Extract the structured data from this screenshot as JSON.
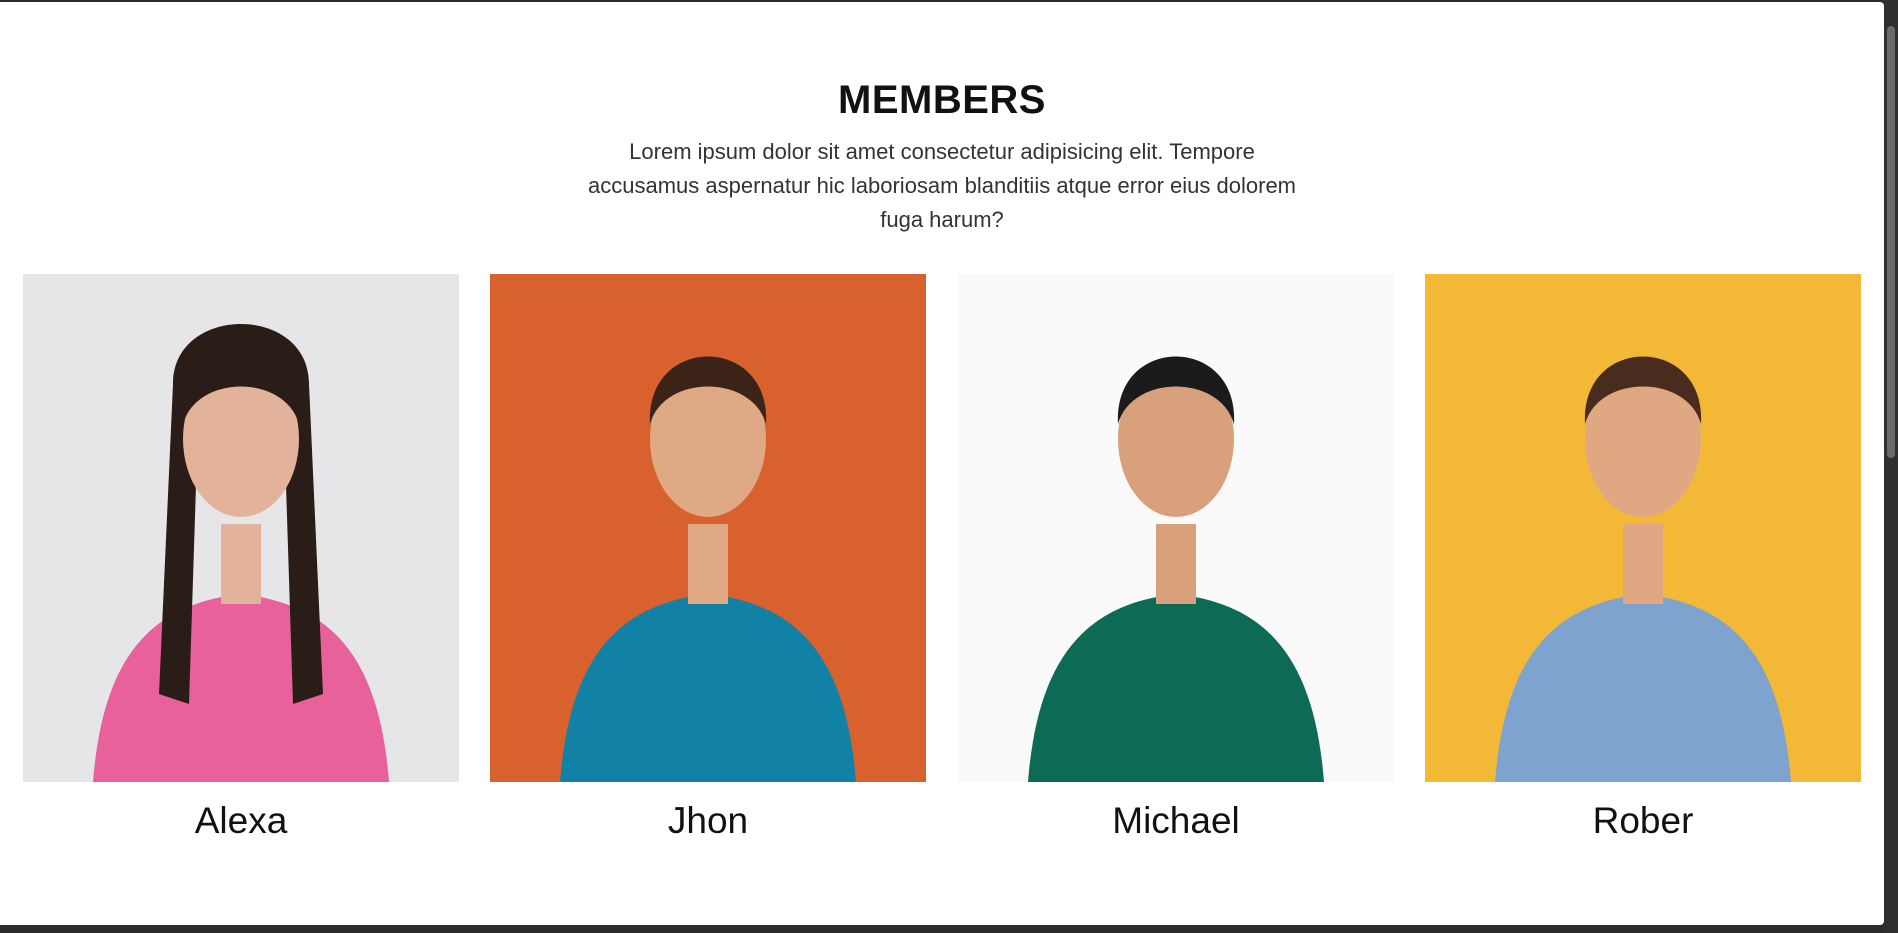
{
  "section": {
    "title": "MEMBERS",
    "description": "Lorem ipsum dolor sit amet consectetur adipisicing elit. Tempore accusamus aspernatur hic laboriosam blanditiis atque error eius dolorem fuga harum?"
  },
  "members": [
    {
      "name": "Alexa",
      "bg": "#e6e6e8",
      "top": "#e9619a",
      "skin": "#e2b39a",
      "hair": "#2a1c16"
    },
    {
      "name": "Jhon",
      "bg": "#d9612e",
      "top": "#1181a6",
      "skin": "#e0a985",
      "hair": "#3b2417"
    },
    {
      "name": "Michael",
      "bg": "#fafafa",
      "top": "#0d6a55",
      "skin": "#d9a07c",
      "hair": "#1b1b1b"
    },
    {
      "name": "Rober",
      "bg": "#f3b936",
      "top": "#7fa3cf",
      "skin": "#e0a882",
      "hair": "#4a2c1e"
    }
  ]
}
